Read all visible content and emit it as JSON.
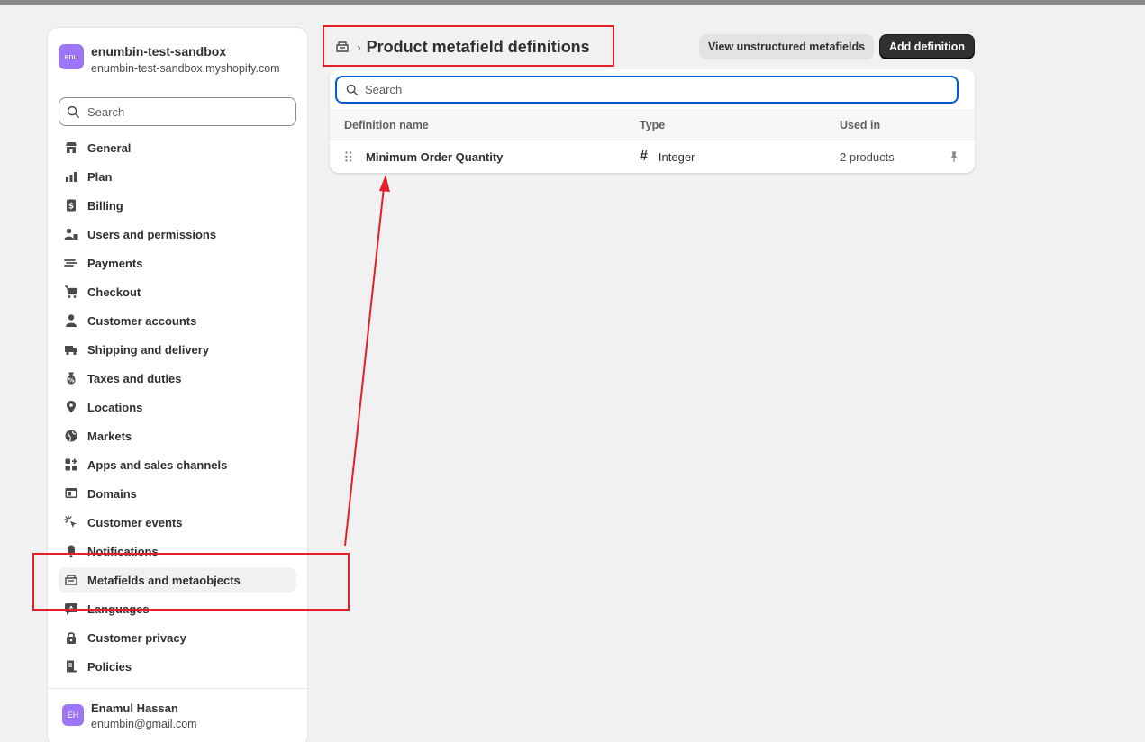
{
  "store": {
    "avatar": "enu",
    "name": "enumbin-test-sandbox",
    "url": "enumbin-test-sandbox.myshopify.com"
  },
  "sidebar": {
    "search_placeholder": "Search",
    "items": [
      {
        "label": "General",
        "icon": "store-icon"
      },
      {
        "label": "Plan",
        "icon": "plan-icon"
      },
      {
        "label": "Billing",
        "icon": "billing-icon"
      },
      {
        "label": "Users and permissions",
        "icon": "users-icon"
      },
      {
        "label": "Payments",
        "icon": "payments-icon"
      },
      {
        "label": "Checkout",
        "icon": "cart-icon"
      },
      {
        "label": "Customer accounts",
        "icon": "person-icon"
      },
      {
        "label": "Shipping and delivery",
        "icon": "truck-icon"
      },
      {
        "label": "Taxes and duties",
        "icon": "tax-icon"
      },
      {
        "label": "Locations",
        "icon": "location-icon"
      },
      {
        "label": "Markets",
        "icon": "globe-icon"
      },
      {
        "label": "Apps and sales channels",
        "icon": "apps-icon"
      },
      {
        "label": "Domains",
        "icon": "domain-icon"
      },
      {
        "label": "Customer events",
        "icon": "cursor-icon"
      },
      {
        "label": "Notifications",
        "icon": "bell-icon"
      },
      {
        "label": "Metafields and metaobjects",
        "icon": "metafields-icon"
      },
      {
        "label": "Languages",
        "icon": "languages-icon"
      },
      {
        "label": "Customer privacy",
        "icon": "lock-icon"
      },
      {
        "label": "Policies",
        "icon": "policy-icon"
      }
    ]
  },
  "user": {
    "avatar": "EH",
    "name": "Enamul Hassan",
    "email": "enumbin@gmail.com"
  },
  "header": {
    "title": "Product metafield definitions",
    "view_unstructured_label": "View unstructured metafields",
    "add_definition_label": "Add definition"
  },
  "table": {
    "search_placeholder": "Search",
    "columns": [
      "Definition name",
      "Type",
      "Used in"
    ],
    "rows": [
      {
        "name": "Minimum Order Quantity",
        "type": "Integer",
        "type_icon": "#",
        "used_in": "2 products"
      }
    ]
  },
  "colors": {
    "accent": "#005bd3",
    "annotation": "#e3202a",
    "avatar": "#9d76f7"
  }
}
